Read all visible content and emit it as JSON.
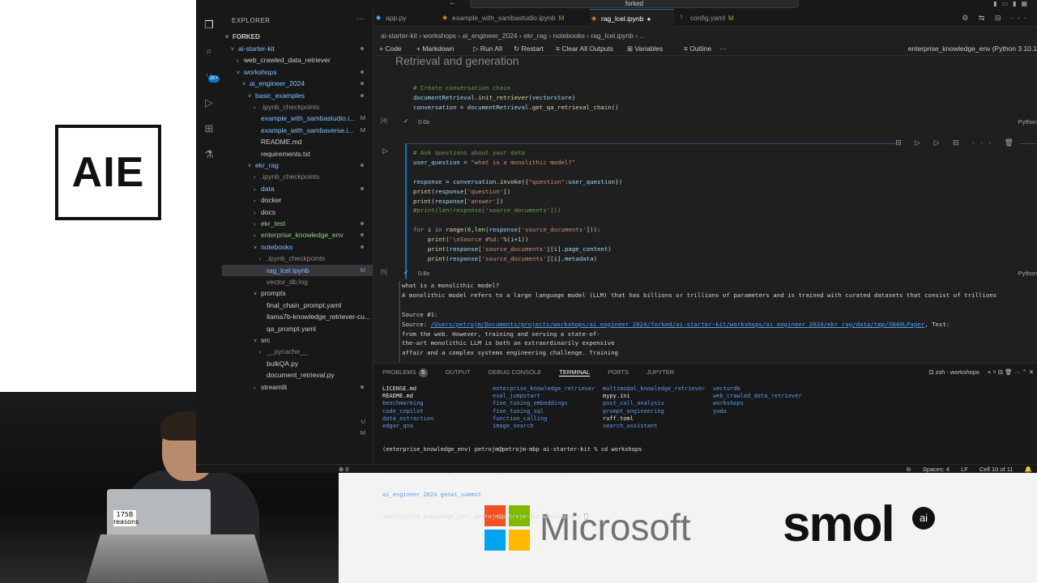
{
  "logo": {
    "text": "AIE"
  },
  "speaker": {
    "laptop_sticker": "175B\nreasons"
  },
  "sponsors": {
    "microsoft": "Microsoft",
    "smol": "smol",
    "smol_badge": "ai",
    "ms_colors": [
      "#f25022",
      "#7fba00",
      "#00a4ef",
      "#ffb900"
    ]
  },
  "titlebar": {
    "search": "forked",
    "back": "←",
    "forward": "→"
  },
  "explorer": {
    "title": "EXPLORER",
    "root": "FORKED",
    "items": [
      {
        "label": "ai-starter-kit",
        "depth": 1,
        "chev": "˅",
        "color": "#7fc0ff",
        "mark": "dot"
      },
      {
        "label": "web_crawled_data_retriever",
        "depth": 2,
        "chev": "›",
        "color": "#cccccc",
        "mark": ""
      },
      {
        "label": "workshops",
        "depth": 2,
        "chev": "˅",
        "color": "#7fc0ff",
        "mark": "dot"
      },
      {
        "label": "ai_engineer_2024",
        "depth": 3,
        "chev": "˅",
        "color": "#7fc0ff",
        "mark": "dot"
      },
      {
        "label": "basic_examples",
        "depth": 4,
        "chev": "˅",
        "color": "#7fc0ff",
        "mark": "dot"
      },
      {
        "label": ".ipynb_checkpoints",
        "depth": 5,
        "chev": "›",
        "color": "#8a8a8a",
        "mark": ""
      },
      {
        "label": "example_with_sambastudio.i...",
        "depth": 5,
        "chev": "",
        "color": "#7fc0ff",
        "mark": "M"
      },
      {
        "label": "example_with_sambaverse.i...",
        "depth": 5,
        "chev": "",
        "color": "#7fc0ff",
        "mark": "M"
      },
      {
        "label": "README.md",
        "depth": 5,
        "chev": "",
        "color": "#cccccc",
        "mark": ""
      },
      {
        "label": "requirements.txt",
        "depth": 5,
        "chev": "",
        "color": "#cccccc",
        "mark": ""
      },
      {
        "label": "ekr_rag",
        "depth": 4,
        "chev": "˅",
        "color": "#7fc0ff",
        "mark": "dot"
      },
      {
        "label": ".ipynb_checkpoints",
        "depth": 5,
        "chev": "›",
        "color": "#8a8a8a",
        "mark": ""
      },
      {
        "label": "data",
        "depth": 5,
        "chev": "›",
        "color": "#7fc0ff",
        "mark": "dot"
      },
      {
        "label": "docker",
        "depth": 5,
        "chev": "›",
        "color": "#cccccc",
        "mark": ""
      },
      {
        "label": "docs",
        "depth": 5,
        "chev": "›",
        "color": "#cccccc",
        "mark": ""
      },
      {
        "label": "ekr_test",
        "depth": 5,
        "chev": "›",
        "color": "#89d185",
        "mark": "dot"
      },
      {
        "label": "enterprise_knowledge_env",
        "depth": 5,
        "chev": "›",
        "color": "#89d185",
        "mark": "dot"
      },
      {
        "label": "notebooks",
        "depth": 5,
        "chev": "˅",
        "color": "#7fc0ff",
        "mark": "dot"
      },
      {
        "label": ".ipynb_checkpoints",
        "depth": 6,
        "chev": "›",
        "color": "#8a8a8a",
        "mark": ""
      },
      {
        "label": "rag_lcel.ipynb",
        "depth": 6,
        "chev": "",
        "color": "#7fc0ff",
        "mark": "M",
        "selected": true
      },
      {
        "label": "vector_db.log",
        "depth": 6,
        "chev": "",
        "color": "#8a8a8a",
        "mark": ""
      },
      {
        "label": "prompts",
        "depth": 5,
        "chev": "˅",
        "color": "#cccccc",
        "mark": ""
      },
      {
        "label": "final_chain_prompt.yaml",
        "depth": 6,
        "chev": "",
        "color": "#cccccc",
        "mark": ""
      },
      {
        "label": "llama7b-knowledge_retriever-cu...",
        "depth": 6,
        "chev": "",
        "color": "#cccccc",
        "mark": ""
      },
      {
        "label": "qa_prompt.yaml",
        "depth": 6,
        "chev": "",
        "color": "#cccccc",
        "mark": ""
      },
      {
        "label": "src",
        "depth": 5,
        "chev": "˅",
        "color": "#cccccc",
        "mark": ""
      },
      {
        "label": "__pycache__",
        "depth": 6,
        "chev": "›",
        "color": "#8a8a8a",
        "mark": ""
      },
      {
        "label": "bulkQA.py",
        "depth": 6,
        "chev": "",
        "color": "#cccccc",
        "mark": ""
      },
      {
        "label": "document_retrieval.py",
        "depth": 6,
        "chev": "",
        "color": "#cccccc",
        "mark": ""
      },
      {
        "label": "streamlit",
        "depth": 5,
        "chev": "›",
        "color": "#cccccc",
        "mark": "dot"
      }
    ],
    "extra_marks": [
      "U",
      "M"
    ]
  },
  "tabs": [
    {
      "label": "app.py",
      "status": "",
      "active": false
    },
    {
      "label": "example_with_sambastudio.ipynb",
      "status": "M",
      "active": false
    },
    {
      "label": "rag_lcel.ipynb",
      "status": "●",
      "active": true
    },
    {
      "label": "config.yaml",
      "status": "M",
      "active": false
    }
  ],
  "breadcrumb": "ai-starter-kit  ›  workshops  ›  ai_engineer_2024  ›  ekr_rag  ›  notebooks  ›  rag_lcel.ipynb  ›  ...",
  "toolbar": {
    "code": "+ Code",
    "markdown": "+ Markdown",
    "run_all": "▷ Run All",
    "restart": "↻ Restart",
    "clear": "≡ Clear All Outputs",
    "variables": "⊞ Variables",
    "outline": "≡ Outline",
    "more": "···",
    "kernel": "enterprise_knowledge_env (Python 3.10.1"
  },
  "behind_title": "Retrieval and generation",
  "cell1": {
    "prompt": "[4]",
    "time": "0.0s",
    "lang": "Python",
    "lines": [
      [
        [
          "cm",
          "# Create conversation chain"
        ]
      ],
      [
        [
          "vr",
          "documentRetrieval"
        ],
        [
          "",
          "."
        ],
        [
          "fn",
          "init_retriever"
        ],
        [
          "",
          "("
        ],
        [
          "vr",
          "vectorstore"
        ],
        [
          "",
          ")"
        ]
      ],
      [
        [
          "vr",
          "conversation"
        ],
        [
          "",
          " = "
        ],
        [
          "vr",
          "documentRetrieval"
        ],
        [
          "",
          "."
        ],
        [
          "fn",
          "get_qa_retrieval_chain"
        ],
        [
          "",
          "()"
        ]
      ]
    ]
  },
  "cell2": {
    "prompt": "[5]",
    "time": "0.8s",
    "lang": "Python",
    "run_icon": "▷",
    "toolbar_icons": "⊟ ▷ ▷ ⊟ ··· 🗑",
    "lines": [
      [
        [
          "cm",
          "# Ask questions about your data"
        ]
      ],
      [
        [
          "vr",
          "user_question"
        ],
        [
          "",
          " = "
        ],
        [
          "st",
          "\"what is a monolithic model?\""
        ]
      ],
      [
        [
          "",
          ""
        ]
      ],
      [
        [
          "vr",
          "response"
        ],
        [
          "",
          " = "
        ],
        [
          "vr",
          "conversation"
        ],
        [
          "",
          "."
        ],
        [
          "fn",
          "invoke"
        ],
        [
          "",
          "({"
        ],
        [
          "st",
          "\"question\""
        ],
        [
          "",
          ":"
        ],
        [
          "vr",
          "user_question"
        ],
        [
          "",
          "})"
        ]
      ],
      [
        [
          "fn",
          "print"
        ],
        [
          "",
          "("
        ],
        [
          "vr",
          "response"
        ],
        [
          "",
          "["
        ],
        [
          "st",
          "'question'"
        ],
        [
          "",
          "])"
        ]
      ],
      [
        [
          "fn",
          "print"
        ],
        [
          "",
          "("
        ],
        [
          "vr",
          "response"
        ],
        [
          "",
          "["
        ],
        [
          "st",
          "'answer'"
        ],
        [
          "",
          "])"
        ]
      ],
      [
        [
          "cm",
          "#print(len(response['source_documents']))"
        ]
      ],
      [
        [
          "",
          ""
        ]
      ],
      [
        [
          "kw",
          "for"
        ],
        [
          "",
          " "
        ],
        [
          "vr",
          "i"
        ],
        [
          "",
          " "
        ],
        [
          "kw",
          "in"
        ],
        [
          "",
          " "
        ],
        [
          "fn",
          "range"
        ],
        [
          "",
          "("
        ],
        [
          "nu",
          "0"
        ],
        [
          "",
          ","
        ],
        [
          "fn",
          "len"
        ],
        [
          "",
          "("
        ],
        [
          "vr",
          "response"
        ],
        [
          "",
          "["
        ],
        [
          "st",
          "'source_documents'"
        ],
        [
          "",
          "])):"
        ]
      ],
      [
        [
          "",
          "    "
        ],
        [
          "fn",
          "print"
        ],
        [
          "",
          "("
        ],
        [
          "st",
          "'\\nSource #%d:'"
        ],
        [
          "",
          "%("
        ],
        [
          "vr",
          "i"
        ],
        [
          "",
          "+"
        ],
        [
          "nu",
          "1"
        ],
        [
          "",
          "))"
        ]
      ],
      [
        [
          "",
          "    "
        ],
        [
          "fn",
          "print"
        ],
        [
          "",
          "("
        ],
        [
          "vr",
          "response"
        ],
        [
          "",
          "["
        ],
        [
          "st",
          "'source_documents'"
        ],
        [
          "",
          "]["
        ],
        [
          "vr",
          "i"
        ],
        [
          "",
          "]."
        ],
        [
          "vr",
          "page_content"
        ],
        [
          "",
          ")"
        ]
      ],
      [
        [
          "",
          "    "
        ],
        [
          "fn",
          "print"
        ],
        [
          "",
          "("
        ],
        [
          "vr",
          "response"
        ],
        [
          "",
          "["
        ],
        [
          "st",
          "'source_documents'"
        ],
        [
          "",
          "]["
        ],
        [
          "vr",
          "i"
        ],
        [
          "",
          "]."
        ],
        [
          "vr",
          "metadata"
        ],
        [
          "",
          ")"
        ]
      ]
    ]
  },
  "output": {
    "line1": "what is a monolithic model?",
    "line2": "A monolithic model refers to a large language model (LLM) that has billions or trillions of parameters and is trained with curated datasets that consist of trillions",
    "line3": "",
    "line4": "Source #1:",
    "source_prefix": "Source: ",
    "source_link": "/Users/petrojm/Documents/projects/workshops/ai_engineer_2024/forked/ai-starter-kit/workshops/ai_engineer_2024/ekr_rag/data/tmp/SN40LPaper",
    "source_suffix": ", Text:",
    "line6": "from the web. However, training and serving a state-of-",
    "line7": "the-art monolithic LLM is both an extraordinarily expensive",
    "line8": "affair and a complex systems engineering challenge. Training"
  },
  "panel": {
    "tabs": [
      "PROBLEMS",
      "OUTPUT",
      "DEBUG CONSOLE",
      "TERMINAL",
      "PORTS",
      "JUPYTER"
    ],
    "problems_count": "5",
    "terminal_name": "zsh - workshops",
    "actions": "+ ˅ ⊟ 🗑 ··· ⌃ ✕",
    "columns": [
      [
        [
          "t-white",
          "LICENSE.md"
        ],
        [
          "t-white",
          "README.md"
        ],
        [
          "t-blue",
          "benchmarking"
        ],
        [
          "t-blue",
          "code_copilot"
        ],
        [
          "t-blue",
          "data_extraction"
        ],
        [
          "t-blue",
          "edgar_qna"
        ]
      ],
      [
        [
          "t-blue",
          "enterprise_knowledge_retriever"
        ],
        [
          "t-blue",
          "eval_jumpstart"
        ],
        [
          "t-blue",
          "fine_tuning_embeddings"
        ],
        [
          "t-blue",
          "fine_tuning_sql"
        ],
        [
          "t-blue",
          "function_calling"
        ],
        [
          "t-blue",
          "image_search"
        ]
      ],
      [
        [
          "t-blue",
          "multimodal_knowledge_retriever"
        ],
        [
          "t-white",
          "mypy.ini"
        ],
        [
          "t-blue",
          "post_call_analysis"
        ],
        [
          "t-blue",
          "prompt_engineering"
        ],
        [
          "t-white",
          "ruff.toml"
        ],
        [
          "t-blue",
          "search_assistant"
        ]
      ],
      [
        [
          "t-blue",
          "vectordb"
        ],
        [
          "t-blue",
          "web_crawled_data_retriever"
        ],
        [
          "t-blue",
          "workshops"
        ],
        [
          "t-blue",
          "yoda"
        ],
        [
          "",
          ""
        ],
        [
          "",
          ""
        ]
      ]
    ],
    "prompt1": "(enterprise_knowledge_env) petrojm@petrojm-mbp ai-starter-kit % cd workshops",
    "prompt2": "(enterprise_knowledge_env) petrojm@petrojm-mbp workshops % ls",
    "prompt3": "ai_engineer_2024 genai_summit",
    "prompt4": "(enterprise_knowledge_env) petrojm@petrojm-mbp workshops % "
  },
  "statusbar": {
    "left": "⊗ 0",
    "spaces": "Spaces: 4",
    "eol": "LF",
    "cell": "Cell 10 of 11"
  }
}
